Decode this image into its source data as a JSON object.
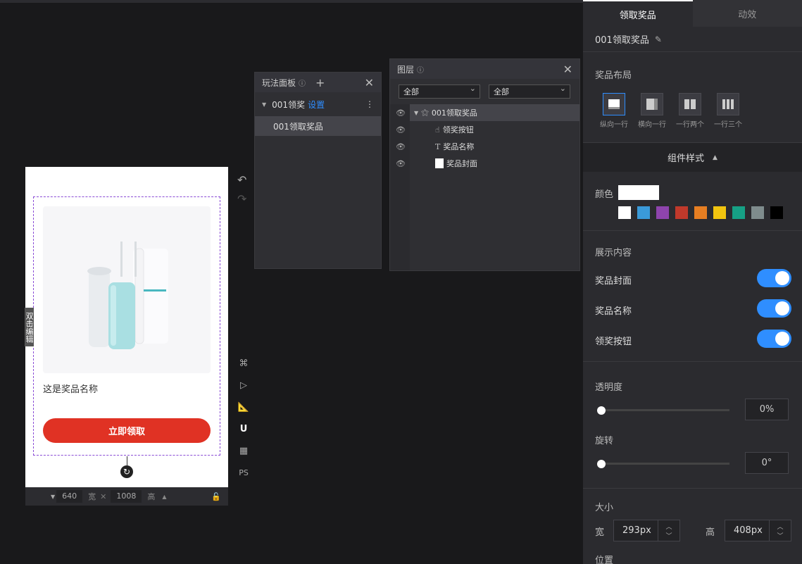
{
  "canvas": {
    "double_click_tag": "双击编辑",
    "prize_name": "这是奖品名称",
    "claim_button": "立即领取",
    "width_value": "640",
    "width_label": "宽",
    "height_value": "1008",
    "height_label": "高",
    "tools_ps": "PS"
  },
  "play_panel": {
    "title": "玩法面板",
    "root_item": "001领奖",
    "settings_link": "设置",
    "child_item": "001领取奖品"
  },
  "layer_panel": {
    "title": "图层",
    "filter_left": "全部",
    "filter_right": "全部",
    "layers": [
      "001领取奖品",
      "领奖按钮",
      "奖品名称",
      "奖品封面"
    ]
  },
  "right_panel": {
    "tabs": [
      "领取奖品",
      "动效"
    ],
    "component_name": "001领取奖品",
    "layout_title": "奖品布局",
    "layout_options": [
      "纵向一行",
      "横向一行",
      "一行两个",
      "一行三个"
    ],
    "style_section": "组件样式",
    "color_label": "颜色",
    "color_current": "#ffffff",
    "swatches": [
      "#ffffff",
      "#3a9ad9",
      "#8e44ad",
      "#c0392b",
      "#e67e22",
      "#f1c40f",
      "#16a085",
      "#7f8c8d",
      "#000000"
    ],
    "display_title": "展示内容",
    "toggles": [
      {
        "label": "奖品封面",
        "on": true
      },
      {
        "label": "奖品名称",
        "on": true
      },
      {
        "label": "领奖按钮",
        "on": true
      }
    ],
    "opacity_label": "透明度",
    "opacity_value": "0%",
    "rotation_label": "旋转",
    "rotation_value": "0°",
    "size_title": "大小",
    "width_label": "宽",
    "width_value": "293px",
    "height_label": "高",
    "height_value": "408px",
    "position_title": "位置"
  }
}
